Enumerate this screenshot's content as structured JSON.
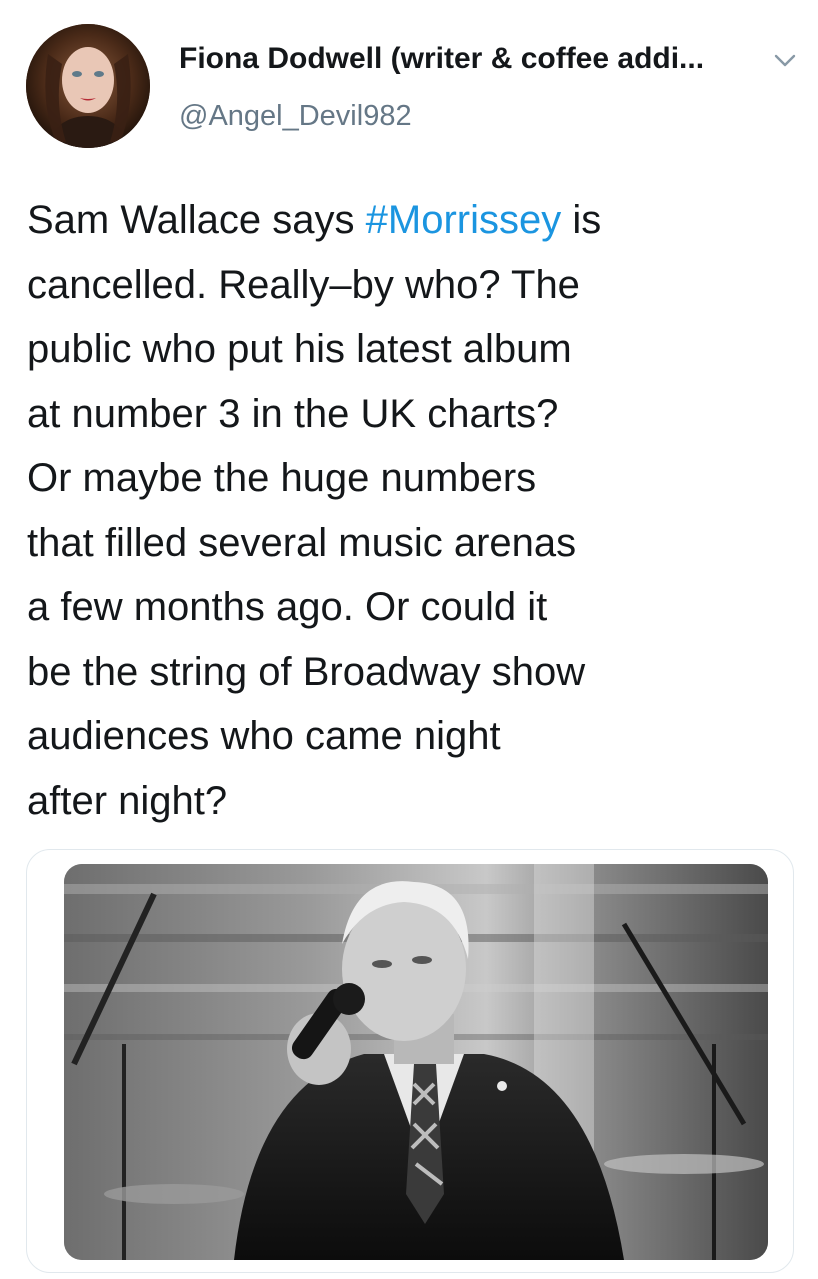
{
  "tweet": {
    "author": {
      "display_name": "Fiona Dodwell (writer & coffee addi...",
      "handle": "@Angel_Devil982",
      "avatar_icon": "profile-photo"
    },
    "menu_icon": "chevron-down-icon",
    "text_lines": [
      [
        "Sam Wallace says ",
        "#Morrissey",
        " is"
      ],
      "cancelled. Really–by who? The",
      "public who put his latest album",
      "at number 3 in the UK charts?",
      "Or maybe the huge numbers",
      "that filled several music arenas",
      "a few months ago. Or could it",
      "be the string of Broadway show",
      "audiences who came night",
      "after night?"
    ],
    "text": {
      "line1_before": "Sam Wallace says ",
      "hashtag": "#Morrissey",
      "line1_after": " is",
      "line2": "cancelled. Really–by who? The",
      "line3": "public who put his latest album",
      "line4": "at number 3 in the UK charts?",
      "line5": "Or maybe the huge numbers",
      "line6": "that filled several music arenas",
      "line7": "a few months ago. Or could it",
      "line8": "be the string of Broadway show",
      "line9": "audiences who came night",
      "line10": "after night?"
    },
    "media": {
      "type": "photo",
      "description_icon": "black-and-white-photo-of-singer-with-microphone"
    }
  },
  "colors": {
    "text": "#14171a",
    "secondary": "#657786",
    "hashtag": "#1b95e0",
    "card_border": "#e1e8ed"
  }
}
